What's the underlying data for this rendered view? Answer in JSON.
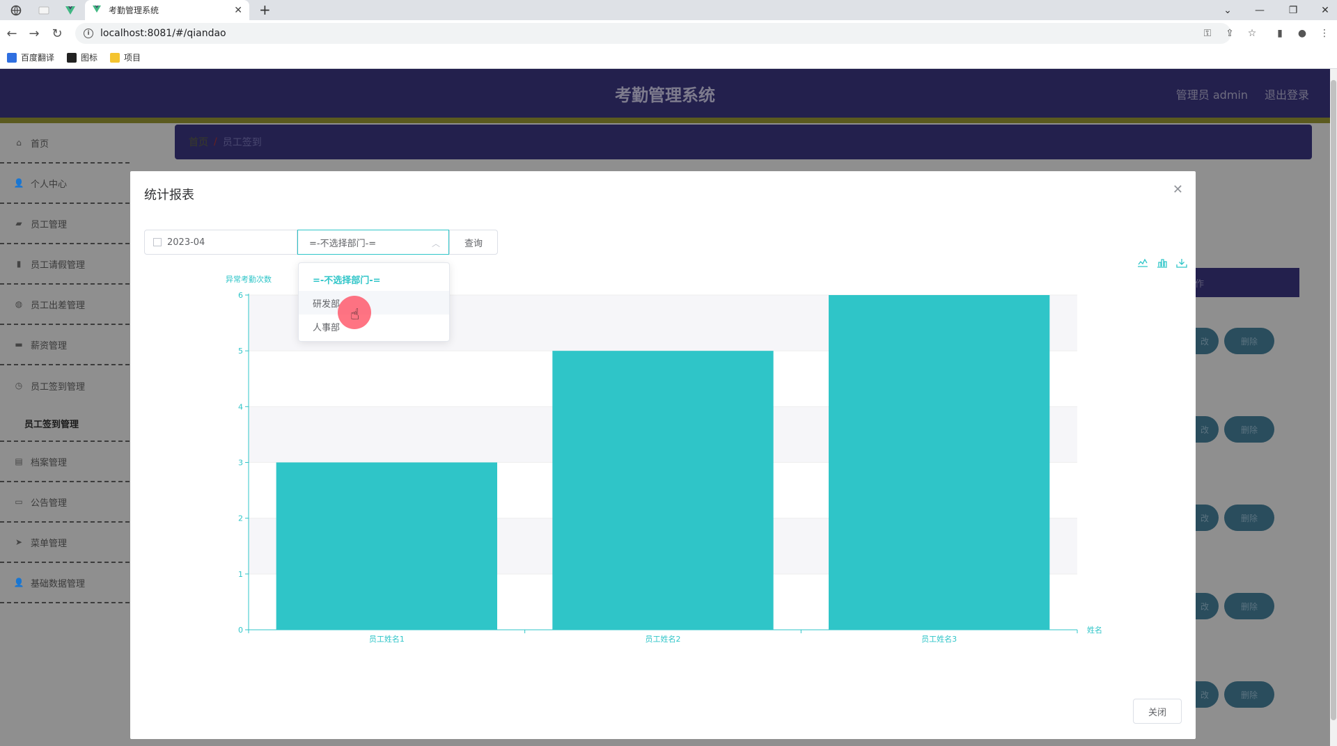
{
  "browser": {
    "tab_title": "考勤管理系统",
    "url": "localhost:8081/#/qiandao",
    "bookmarks": [
      "百度翻译",
      "图标",
      "项目"
    ]
  },
  "header": {
    "title": "考勤管理系统",
    "user": "管理员 admin",
    "logout": "退出登录"
  },
  "sidebar": {
    "items": [
      {
        "label": "首页",
        "icon": "home-icon"
      },
      {
        "label": "个人中心",
        "icon": "user-icon"
      },
      {
        "label": "员工管理",
        "icon": "briefcase-icon"
      },
      {
        "label": "员工请假管理",
        "icon": "bar-chart-icon"
      },
      {
        "label": "员工出差管理",
        "icon": "globe-icon"
      },
      {
        "label": "薪资管理",
        "icon": "wallet-icon"
      },
      {
        "label": "员工签到管理",
        "icon": "clock-icon"
      }
    ],
    "sub_item": "员工签到管理",
    "items_after": [
      {
        "label": "档案管理",
        "icon": "clipboard-icon"
      },
      {
        "label": "公告管理",
        "icon": "monitor-icon"
      },
      {
        "label": "菜单管理",
        "icon": "send-icon"
      },
      {
        "label": "基础数据管理",
        "icon": "user-icon"
      }
    ]
  },
  "breadcrumb": {
    "home": "首页",
    "separator": "/",
    "current": "员工签到"
  },
  "table": {
    "header_fragment": "作",
    "edit_fragment": "改",
    "delete_label": "删除"
  },
  "dialog": {
    "title": "统计报表",
    "date_value": "2023-04",
    "department_value": "=-不选择部门-=",
    "query_button": "查询",
    "close_button": "关闭",
    "dropdown_options": [
      "=-不选择部门-=",
      "研发部",
      "人事部"
    ],
    "selected_option": 0,
    "hovered_option": 1
  },
  "chart_data": {
    "type": "bar",
    "categories": [
      "员工姓名1",
      "员工姓名2",
      "员工姓名3"
    ],
    "values": [
      3,
      5,
      6
    ],
    "ylabel": "异常考勤次数",
    "xlabel": "姓名",
    "ylim": [
      0,
      6
    ],
    "yticks": [
      0,
      1,
      2,
      3,
      4,
      5,
      6
    ],
    "bar_color": "#2fc5c8",
    "grid": true
  },
  "colors": {
    "accent": "#2fc5c8",
    "header_bg": "#23204d"
  }
}
